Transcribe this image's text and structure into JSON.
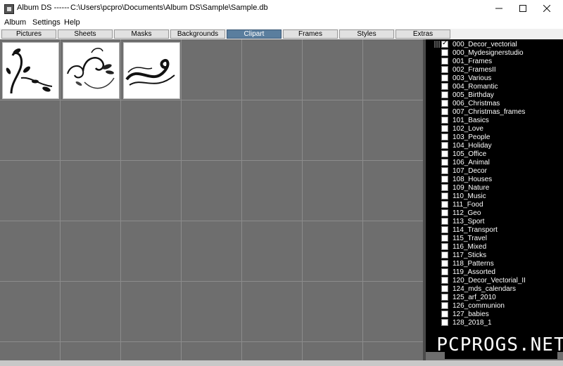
{
  "window": {
    "app_title": "Album DS ------",
    "path": "C:\\Users\\pcpro\\Documents\\Album DS\\Sample\\Sample.db",
    "minimize_icon": "minimize-icon",
    "maximize_icon": "maximize-icon",
    "close_icon": "close-icon"
  },
  "menu": [
    "Album",
    "Settings",
    "Help"
  ],
  "tabs": [
    "Pictures",
    "Sheets",
    "Masks",
    "Backgrounds",
    "Clipart",
    "Frames",
    "Styles",
    "Extras"
  ],
  "active_tab": "Clipart",
  "colors": {
    "active_tab": "#5a7e9e",
    "grid_bg": "#6e6e6e",
    "sidebar_bg": "#000000"
  },
  "thumbnails": [
    {
      "name": "corner-swirl-clipart"
    },
    {
      "name": "flourish-swirls-clipart"
    },
    {
      "name": "wave-flourish-clipart"
    }
  ],
  "categories": [
    {
      "label": "000_Decor_vectorial",
      "checked": true
    },
    {
      "label": "000_Mydesignerstudio",
      "checked": false
    },
    {
      "label": "001_Frames",
      "checked": false
    },
    {
      "label": "002_FramesII",
      "checked": false
    },
    {
      "label": "003_Various",
      "checked": false
    },
    {
      "label": "004_Romantic",
      "checked": false
    },
    {
      "label": "005_Birthday",
      "checked": false
    },
    {
      "label": "006_Christmas",
      "checked": false
    },
    {
      "label": "007_Christmas_frames",
      "checked": false
    },
    {
      "label": "101_Basics",
      "checked": false
    },
    {
      "label": "102_Love",
      "checked": false
    },
    {
      "label": "103_People",
      "checked": false
    },
    {
      "label": "104_Holiday",
      "checked": false
    },
    {
      "label": "105_Office",
      "checked": false
    },
    {
      "label": "106_Animal",
      "checked": false
    },
    {
      "label": "107_Decor",
      "checked": false
    },
    {
      "label": "108_Houses",
      "checked": false
    },
    {
      "label": "109_Nature",
      "checked": false
    },
    {
      "label": "110_Music",
      "checked": false
    },
    {
      "label": "111_Food",
      "checked": false
    },
    {
      "label": "112_Geo",
      "checked": false
    },
    {
      "label": "113_Sport",
      "checked": false
    },
    {
      "label": "114_Transport",
      "checked": false
    },
    {
      "label": "115_Travel",
      "checked": false
    },
    {
      "label": "116_Mixed",
      "checked": false
    },
    {
      "label": "117_Sticks",
      "checked": false
    },
    {
      "label": "118_Patterns",
      "checked": false
    },
    {
      "label": "119_Assorted",
      "checked": false
    },
    {
      "label": "120_Decor_Vectorial_II",
      "checked": false
    },
    {
      "label": "124_mds_calendars",
      "checked": false
    },
    {
      "label": "125_arf_2010",
      "checked": false
    },
    {
      "label": "126_communion",
      "checked": false
    },
    {
      "label": "127_babies",
      "checked": false
    },
    {
      "label": "128_2018_1",
      "checked": false
    }
  ],
  "watermark": "PCPROGS.NET"
}
